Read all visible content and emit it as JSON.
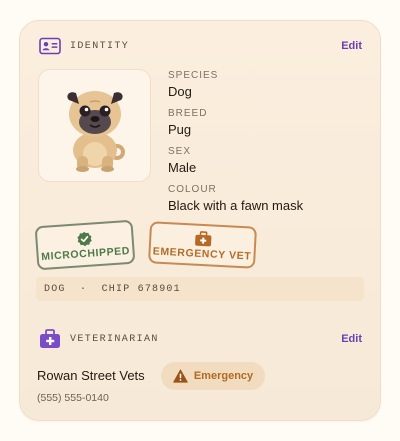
{
  "identity": {
    "section_label": "IDENTITY",
    "edit_label": "Edit",
    "header_icon": "id-card-icon",
    "photo_icon": "pug-illustration",
    "fields": [
      {
        "label": "SPECIES",
        "value": "Dog"
      },
      {
        "label": "BREED",
        "value": "Pug"
      },
      {
        "label": "SEX",
        "value": "Male"
      },
      {
        "label": "COLOUR",
        "value": "Black with a fawn mask"
      }
    ],
    "stamps": [
      {
        "label": "MICROCHIPPED",
        "icon": "verified-badge-icon",
        "color": "#4e7a48"
      },
      {
        "label": "EMERGENCY VET",
        "icon": "medical-kit-icon",
        "color": "#b56a26"
      }
    ],
    "chip_line": "DOG  ·  CHIP 678901"
  },
  "veterinarian": {
    "section_label": "VETERINARIAN",
    "edit_label": "Edit",
    "header_icon": "medical-kit-icon",
    "name": "Rowan Street Vets",
    "badge_label": "Emergency",
    "badge_icon": "warning-icon",
    "phone": "(555) 555-0140"
  },
  "colors": {
    "accent": "#6a40b4",
    "card_bg": "#f9ecdb",
    "emergency": "#b06a22",
    "verified": "#4e7a48"
  }
}
